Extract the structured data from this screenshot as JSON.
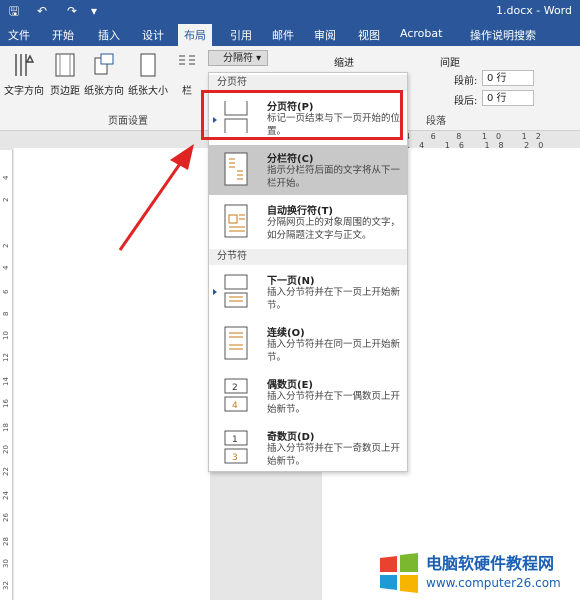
{
  "window": {
    "title": "1.docx - Word"
  },
  "tabs": [
    "文件",
    "开始",
    "插入",
    "设计",
    "布局",
    "引用",
    "邮件",
    "审阅",
    "视图",
    "Acrobat",
    "操作说明搜索"
  ],
  "active_tab": "布局",
  "ribbon": {
    "buttons": [
      "文字方向",
      "页边距",
      "纸张方向",
      "纸张大小",
      "栏"
    ],
    "group_label": "页面设置",
    "paragraph_label": "段落",
    "breaks_button": "分隔符",
    "indent_label": "缩进",
    "spacing_label": "间距",
    "before_label": "段前:",
    "after_label": "段后:",
    "before_value": "0 行",
    "after_value": "0 行"
  },
  "menu": {
    "section1": "分页符",
    "section2": "分节符",
    "items": [
      {
        "title": "分页符(P)",
        "desc": "标记一页结束与下一页开始的位置。"
      },
      {
        "title": "分栏符(C)",
        "desc": "指示分栏符后面的文字将从下一栏开始。"
      },
      {
        "title": "自动换行符(T)",
        "desc": "分隔网页上的对象周围的文字，如分隔题注文字与正文。"
      },
      {
        "title": "下一页(N)",
        "desc": "插入分节符并在下一页上开始新节。"
      },
      {
        "title": "连续(O)",
        "desc": "插入分节符并在同一页上开始新节。"
      },
      {
        "title": "偶数页(E)",
        "desc": "插入分节符并在下一偶数页上开始新节。"
      },
      {
        "title": "奇数页(D)",
        "desc": "插入分节符并在下一奇数页上开始新节。"
      }
    ]
  },
  "ruler": {
    "top": "4 6 8 10 12 14 16 18 20 22",
    "left": [
      "4",
      "2",
      "2",
      "4",
      "6",
      "8",
      "10",
      "12",
      "14",
      "16",
      "18",
      "20",
      "22",
      "24",
      "26",
      "28",
      "30",
      "32"
    ]
  },
  "watermark": {
    "brand": "电脑软硬件教程网",
    "url": "www.computer26.com"
  },
  "colors": {
    "accent": "#2b579a",
    "highlight": "#e02424"
  }
}
